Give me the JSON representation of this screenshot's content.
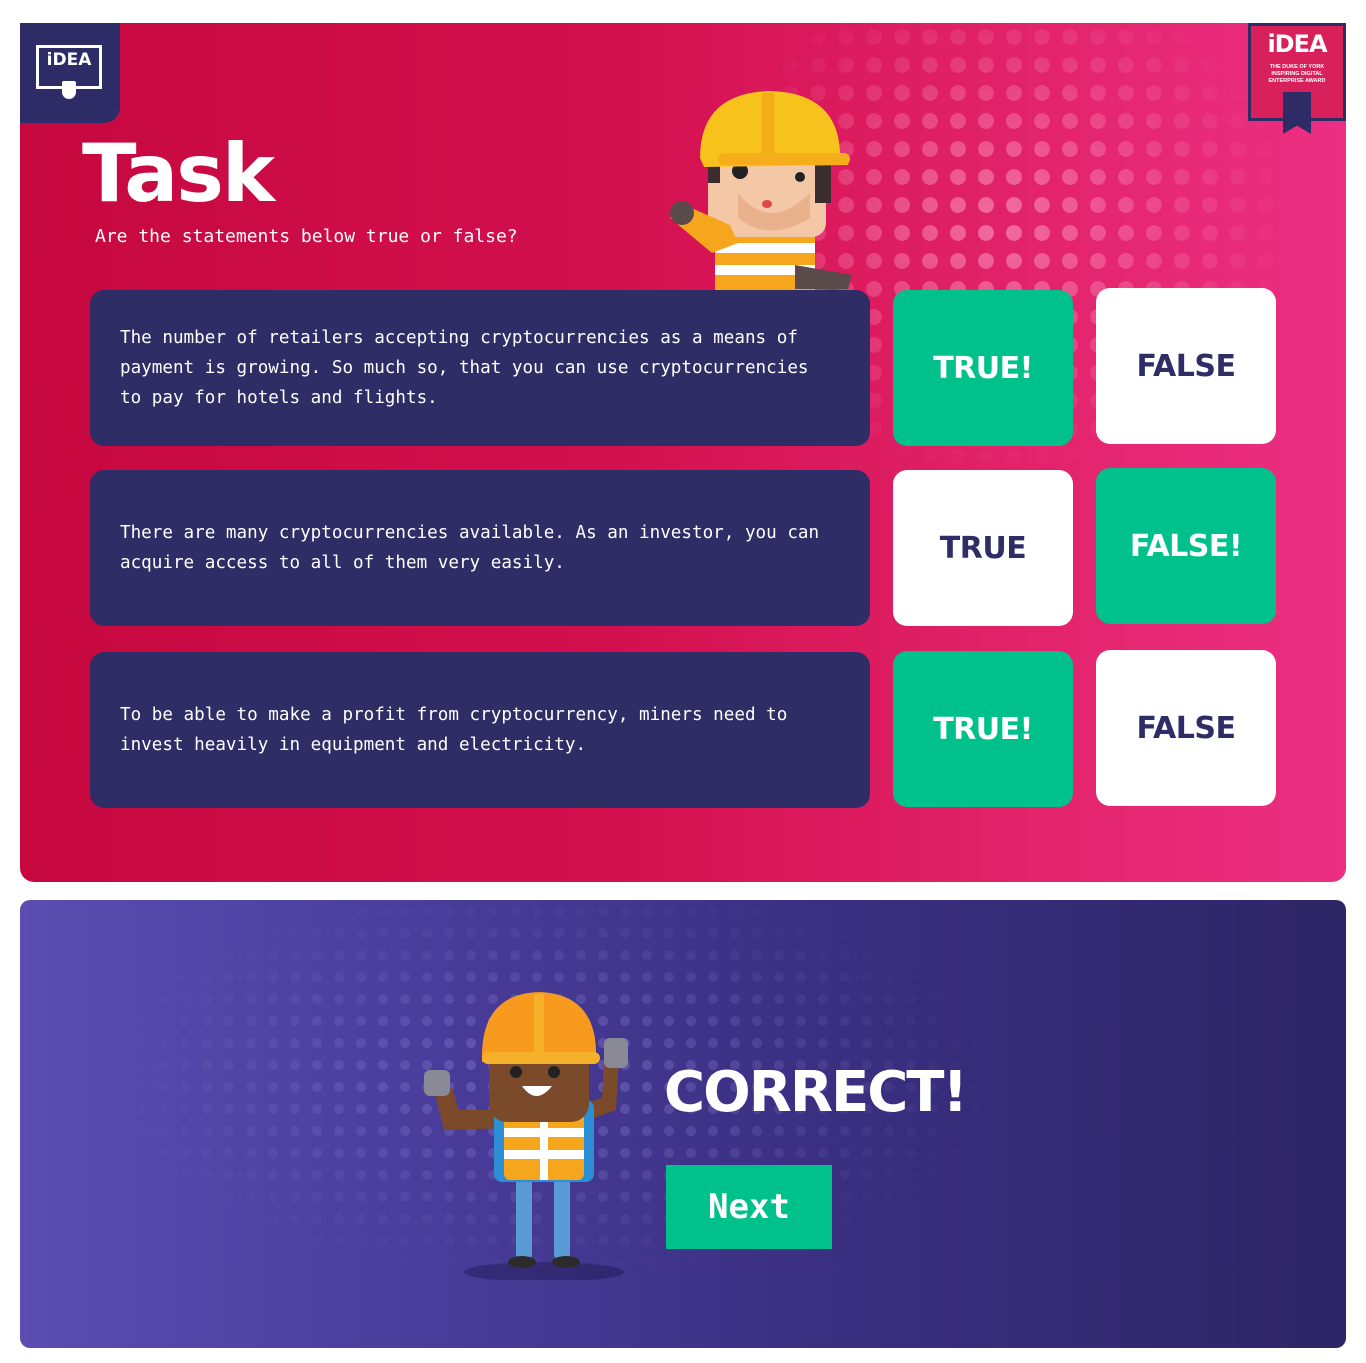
{
  "branding": {
    "logo_left_text": "iDEA",
    "logo_right_text": "iDEA",
    "logo_right_subtitle": "The Duke of York Inspiring Digital Enterprise Award"
  },
  "task": {
    "title": "Task",
    "subtitle": "Are the statements below true or false?",
    "statements": [
      {
        "text": "The number of retailers accepting cryptocurrencies as a means of payment is growing. So much so, that you can use cryptocurrencies to pay for hotels and flights.",
        "true_label": "TRUE!",
        "false_label": "FALSE",
        "selected": "true"
      },
      {
        "text": "There are many cryptocurrencies available. As an investor, you can acquire access to all of them very easily.",
        "true_label": "TRUE",
        "false_label": "FALSE!",
        "selected": "false"
      },
      {
        "text": "To be able to make a profit from cryptocurrency, miners need to invest heavily in equipment and electricity.",
        "true_label": "TRUE!",
        "false_label": "FALSE",
        "selected": "true"
      }
    ]
  },
  "result": {
    "message": "CORRECT!",
    "next_label": "Next"
  },
  "colors": {
    "navy": "#2f2d66",
    "green": "#00c18c",
    "crimson": "#c6083f",
    "pink": "#ec2f83",
    "purple": "#5b4db1"
  }
}
